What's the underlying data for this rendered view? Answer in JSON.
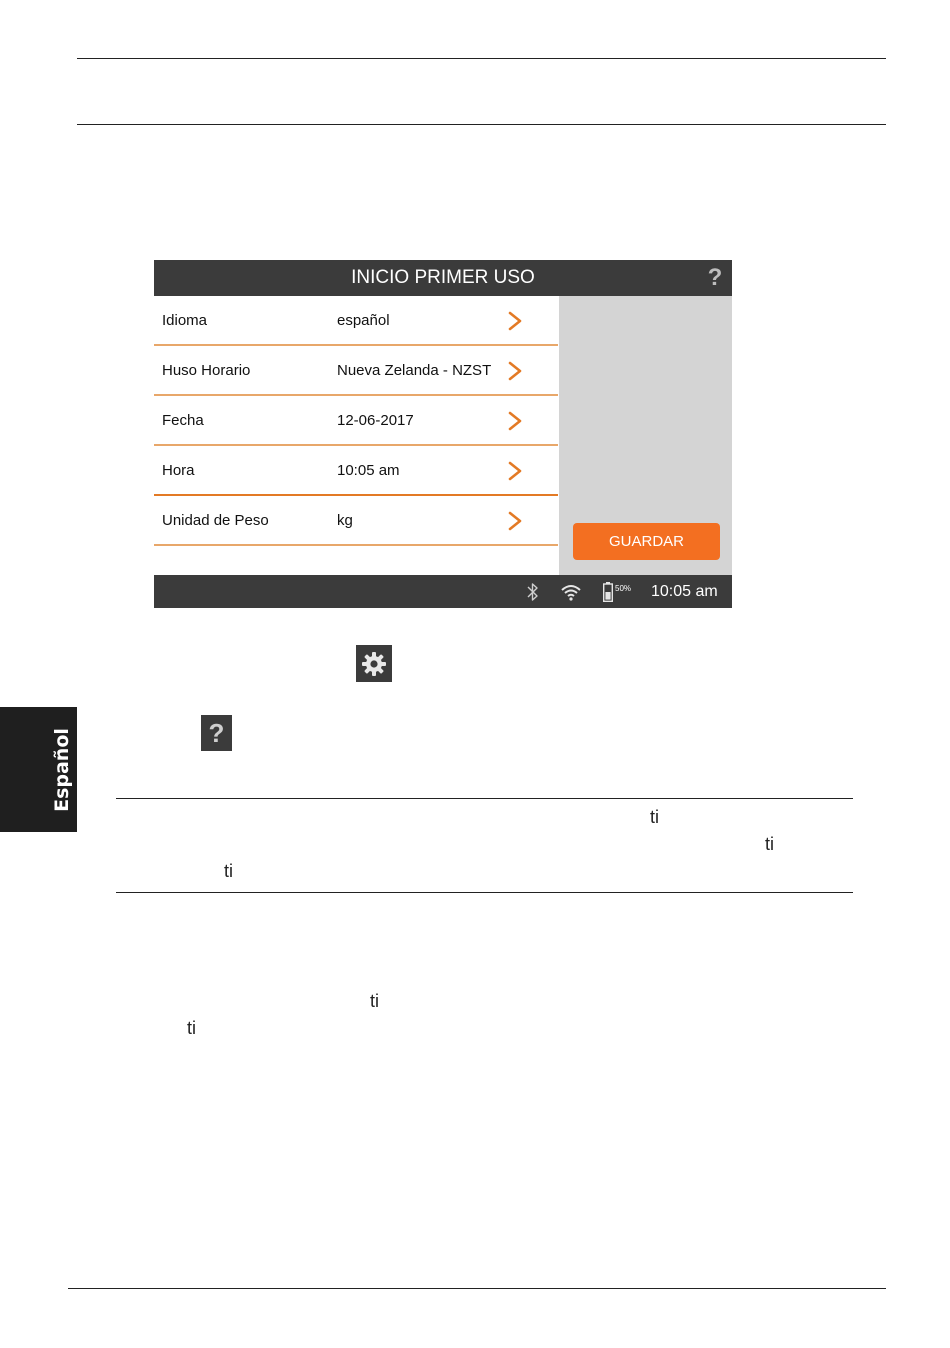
{
  "screen": {
    "title": "INICIO PRIMER USO",
    "help_label": "?",
    "rows": [
      {
        "label": "Idioma",
        "value": "español"
      },
      {
        "label": "Huso Horario",
        "value": "Nueva Zelanda - NZST"
      },
      {
        "label": "Fecha",
        "value": "12-06-2017"
      },
      {
        "label": "Hora",
        "value": "10:05 am"
      },
      {
        "label": "Unidad de Peso",
        "value": "kg"
      }
    ],
    "save_label": "GUARDAR",
    "status": {
      "battery_percent": "50%",
      "clock": "10:05 am"
    }
  },
  "icons": {
    "help_label": "?"
  },
  "side_tab": "Español",
  "fragments": [
    "ti",
    "ti",
    "ti",
    "ti",
    "ti"
  ],
  "colors": {
    "accent": "#f36f21",
    "bar": "#3b3b3b",
    "panel": "#d4d4d4"
  }
}
